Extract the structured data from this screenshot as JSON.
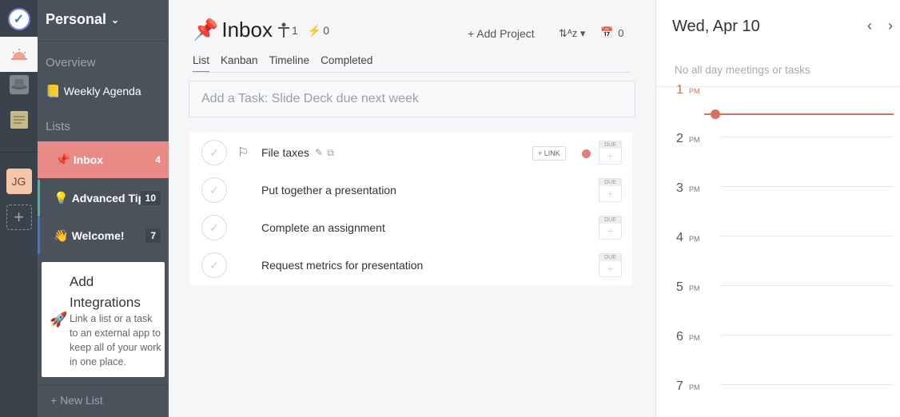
{
  "rail": {
    "avatar_initials": "JG",
    "add_symbol": "+"
  },
  "sidebar": {
    "workspace": "Personal",
    "overview_label": "Overview",
    "weekly_agenda": "Weekly Agenda",
    "lists_label": "Lists",
    "items": [
      {
        "label": "Inbox",
        "count": "4"
      },
      {
        "label": "Advanced Tips",
        "count": "10"
      },
      {
        "label": "Welcome!",
        "count": "7"
      }
    ],
    "integrations": {
      "title": "Add Integrations",
      "description": "Link a list or a task to an external app to keep all of your work in one place."
    },
    "new_list": "+ New List"
  },
  "main": {
    "title": "Inbox",
    "members_count": "1",
    "power_count": "0",
    "add_project": "+ Add Project",
    "calendar_count": "0",
    "tabs": [
      "List",
      "Kanban",
      "Timeline",
      "Completed"
    ],
    "active_tab": "List",
    "add_task_placeholder": "Add a Task: Slide Deck due next week",
    "link_label": "+ LINK",
    "due_label": "DUE",
    "tasks": [
      {
        "name": "File taxes"
      },
      {
        "name": "Put together a presentation"
      },
      {
        "name": "Complete an assignment"
      },
      {
        "name": "Request metrics for presentation"
      }
    ]
  },
  "calendar": {
    "date": "Wed, Apr 10",
    "empty_text": "No all day meetings or tasks",
    "hours": [
      {
        "num": "1",
        "ap": "PM"
      },
      {
        "num": "2",
        "ap": "PM"
      },
      {
        "num": "3",
        "ap": "PM"
      },
      {
        "num": "4",
        "ap": "PM"
      },
      {
        "num": "5",
        "ap": "PM"
      },
      {
        "num": "6",
        "ap": "PM"
      },
      {
        "num": "7",
        "ap": "PM"
      }
    ],
    "now_line_color": "#d8725e"
  },
  "colors": {
    "inbox_active": "#ea8a85",
    "tips_accent": "#4ab7a3",
    "welcome_accent": "#3f78d4",
    "priority_dot": "#e57c78"
  },
  "icons": [
    "app-logo-icon",
    "today-sun-icon",
    "hat-icon",
    "notepad-icon",
    "plus-icon",
    "chevron-down-icon",
    "pushpin-icon",
    "person-icon",
    "lightning-icon",
    "sort-icon",
    "calendar-icon",
    "check-icon",
    "flag-icon",
    "pencil-icon",
    "copy-icon",
    "rocket-icon",
    "chevron-left-icon",
    "chevron-right-icon"
  ]
}
